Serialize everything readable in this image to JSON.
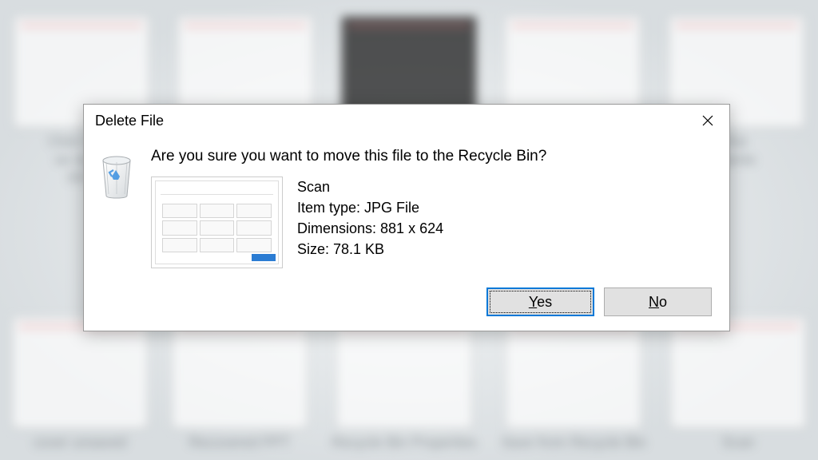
{
  "dialog": {
    "title": "Delete File",
    "question": "Are you sure you want to move this file to the Recycle Bin?",
    "file": {
      "name": "Scan",
      "type_label": "Item type: JPG File",
      "dimensions_label": "Dimensions: 881 x 624",
      "size_label": "Size: 78.1 KB"
    },
    "buttons": {
      "yes": "Yes",
      "no": "No"
    }
  },
  "background": {
    "labels": {
      "tl1": "Click Save",
      "tl2": "ve recov",
      "tl3": "PPT",
      "tr1": "fice",
      "tr2": "ments",
      "b1": "cover unsaved",
      "b2": "Recovered PPT",
      "b3": "Recycle Bin Properties",
      "b4": "Save from Recycle Bin",
      "b5": "Scan"
    }
  }
}
